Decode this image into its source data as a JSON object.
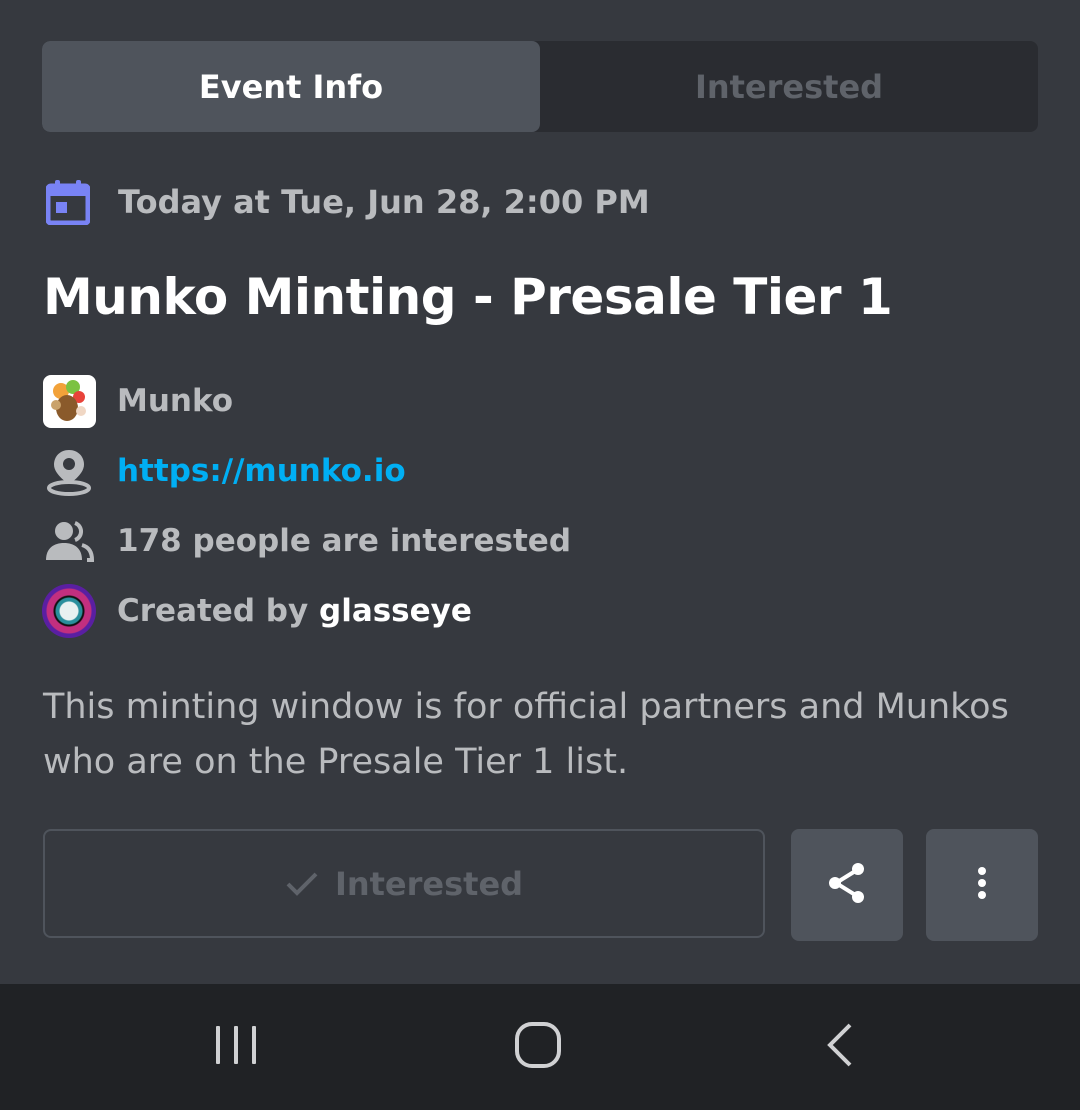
{
  "tabs": [
    {
      "label": "Event Info",
      "active": true
    },
    {
      "label": "Interested",
      "active": false
    }
  ],
  "event": {
    "date": "Today at Tue, Jun 28, 2:00 PM",
    "title": "Munko Minting - Presale Tier 1",
    "server_name": "Munko",
    "location_url": "https://munko.io",
    "interested_count_text": "178 people are interested",
    "created_by_prefix": "Created by ",
    "creator": "glasseye",
    "description": "This minting window is for official partners and Munkos who are on the Presale Tier 1 list."
  },
  "actions": {
    "interested_label": "Interested",
    "share_icon": "share-icon",
    "more_icon": "more-vertical-icon"
  },
  "navbar": {
    "recents_icon": "recents-icon",
    "home_icon": "home-icon",
    "back_icon": "back-icon"
  },
  "colors": {
    "background": "#36393f",
    "accent": "#7983f5",
    "link": "#00aff4",
    "tab_active": "#4f545c"
  }
}
